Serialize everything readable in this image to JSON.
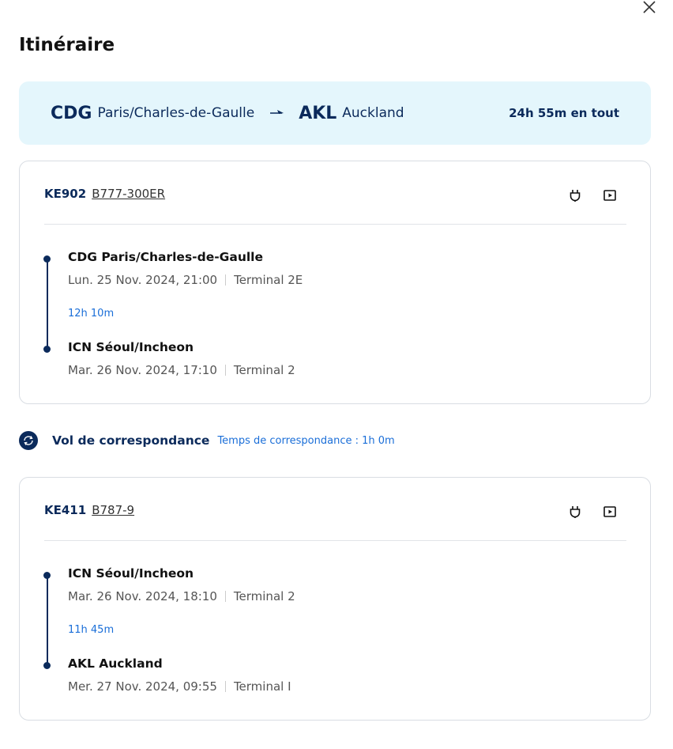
{
  "dialog": {
    "title": "Itinéraire",
    "close_icon": "close-icon"
  },
  "route": {
    "origin_code": "CDG",
    "origin_city": "Paris/Charles-de-Gaulle",
    "destination_code": "AKL",
    "destination_city": "Auckland",
    "total_duration": "24h 55m en tout",
    "arrow_icon": "plane-arrow-icon"
  },
  "connection": {
    "title": "Vol de correspondance",
    "time": "Temps de correspondance : 1h 0m",
    "icon": "connection-icon"
  },
  "flights": [
    {
      "flight_number": "KE902",
      "aircraft": "B777-300ER",
      "amenities": [
        "power-outlet-icon",
        "video-icon"
      ],
      "departure": {
        "name": "CDG Paris/Charles-de-Gaulle",
        "datetime": "Lun. 25 Nov. 2024, 21:00",
        "terminal": "Terminal 2E"
      },
      "duration": "12h 10m",
      "arrival": {
        "name": "ICN Séoul/Incheon",
        "datetime": "Mar. 26 Nov. 2024, 17:10",
        "terminal": "Terminal 2"
      }
    },
    {
      "flight_number": "KE411",
      "aircraft": "B787-9",
      "amenities": [
        "power-outlet-icon",
        "video-icon"
      ],
      "departure": {
        "name": "ICN Séoul/Incheon",
        "datetime": "Mar. 26 Nov. 2024, 18:10",
        "terminal": "Terminal 2"
      },
      "duration": "11h 45m",
      "arrival": {
        "name": "AKL Auckland",
        "datetime": "Mer. 27 Nov. 2024, 09:55",
        "terminal": "Terminal I"
      }
    }
  ],
  "colors": {
    "brand_navy": "#0b2a5b",
    "accent_blue": "#1a6ed8",
    "banner_bg": "#e4f6fc"
  }
}
